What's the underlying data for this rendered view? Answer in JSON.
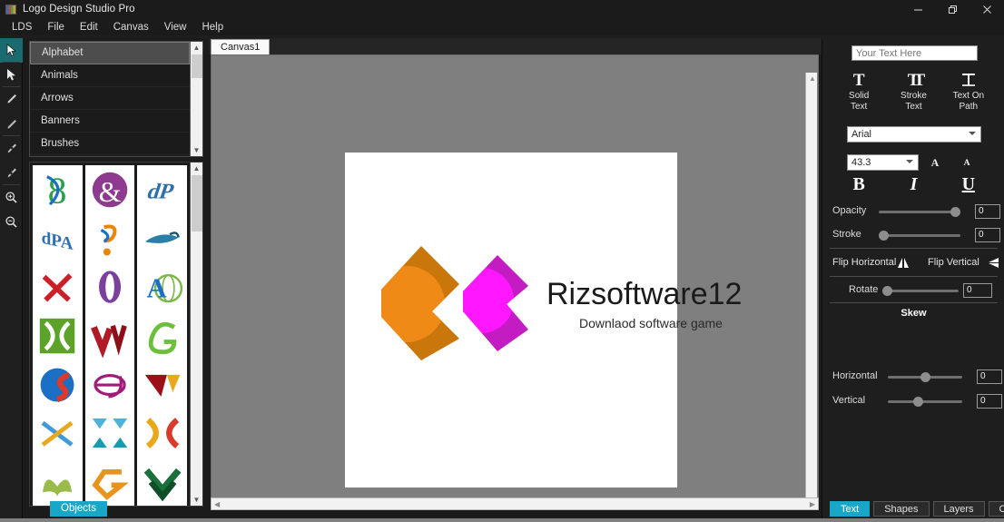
{
  "window": {
    "title": "Logo Design Studio Pro",
    "app_icon": "app-logo-icon",
    "controls": {
      "minimize": "—",
      "restore": "❐",
      "close": "✕"
    }
  },
  "menubar": {
    "items": [
      "LDS",
      "File",
      "Edit",
      "Canvas",
      "View",
      "Help"
    ]
  },
  "toolbar": {
    "tools": [
      {
        "name": "select-tool",
        "icon": "cursor-arrow-icon",
        "active": true
      },
      {
        "name": "direct-select-tool",
        "icon": "pointer-arrow-icon",
        "active": false
      },
      {
        "name": "pen-tool",
        "icon": "pen-icon",
        "active": false
      },
      {
        "name": "pencil-tool",
        "icon": "pencil-icon",
        "active": false
      },
      {
        "name": "add-node-tool",
        "icon": "node-add-icon",
        "active": false
      },
      {
        "name": "edit-node-tool",
        "icon": "node-edit-icon",
        "active": false
      },
      {
        "name": "zoom-in-tool",
        "icon": "magnifier-plus-icon",
        "active": false
      },
      {
        "name": "zoom-out-tool",
        "icon": "magnifier-minus-icon",
        "active": false
      }
    ]
  },
  "library": {
    "categories": [
      {
        "label": "Alphabet",
        "selected": true
      },
      {
        "label": "Animals",
        "selected": false
      },
      {
        "label": "Arrows",
        "selected": false
      },
      {
        "label": "Banners",
        "selected": false
      },
      {
        "label": "Brushes",
        "selected": false
      }
    ],
    "objects_tab_label": "Objects",
    "thumbnail_count": 18
  },
  "canvas": {
    "tab_label": "Canvas1",
    "background_color": "#7f7f7f",
    "artboard_color": "#ffffff",
    "logo": {
      "title": "Rizsoftware12",
      "tagline": "Downlaod software game",
      "shape_color_primary": "#E8860C",
      "shape_color_secondary": "#D41FD4"
    }
  },
  "properties": {
    "text_value": "",
    "text_placeholder": "Your Text Here",
    "modes": [
      {
        "label_line1": "Solid",
        "label_line2": "Text",
        "glyph": "T",
        "name": "solid-text"
      },
      {
        "label_line1": "Stroke",
        "label_line2": "Text",
        "glyph": "T",
        "name": "stroke-text"
      },
      {
        "label_line1": "Text On",
        "label_line2": "Path",
        "glyph": "T",
        "name": "text-on-path"
      }
    ],
    "font_family": "Arial",
    "font_size": "43.3",
    "increase_size_label": "A",
    "decrease_size_label": "A",
    "bold_label": "B",
    "italic_label": "I",
    "underline_label": "U",
    "opacity": {
      "label": "Opacity",
      "value": "0",
      "fill_percent": 92
    },
    "stroke": {
      "label": "Stroke",
      "value": "0",
      "fill_percent": 3
    },
    "flip_horizontal_label": "Flip Horizontal",
    "flip_vertical_label": "Flip Vertical",
    "rotate": {
      "label": "Rotate",
      "value": "0",
      "fill_percent": 3
    },
    "skew_title": "Skew",
    "skew_horizontal": {
      "label": "Horizontal",
      "value": "0",
      "fill_percent": 50
    },
    "skew_vertical": {
      "label": "Vertical",
      "value": "0",
      "fill_percent": 47
    },
    "tabs": [
      {
        "label": "Text",
        "active": true
      },
      {
        "label": "Shapes",
        "active": false
      },
      {
        "label": "Layers",
        "active": false
      },
      {
        "label": "Color",
        "active": false
      }
    ],
    "accent_color": "#19a7c8"
  }
}
